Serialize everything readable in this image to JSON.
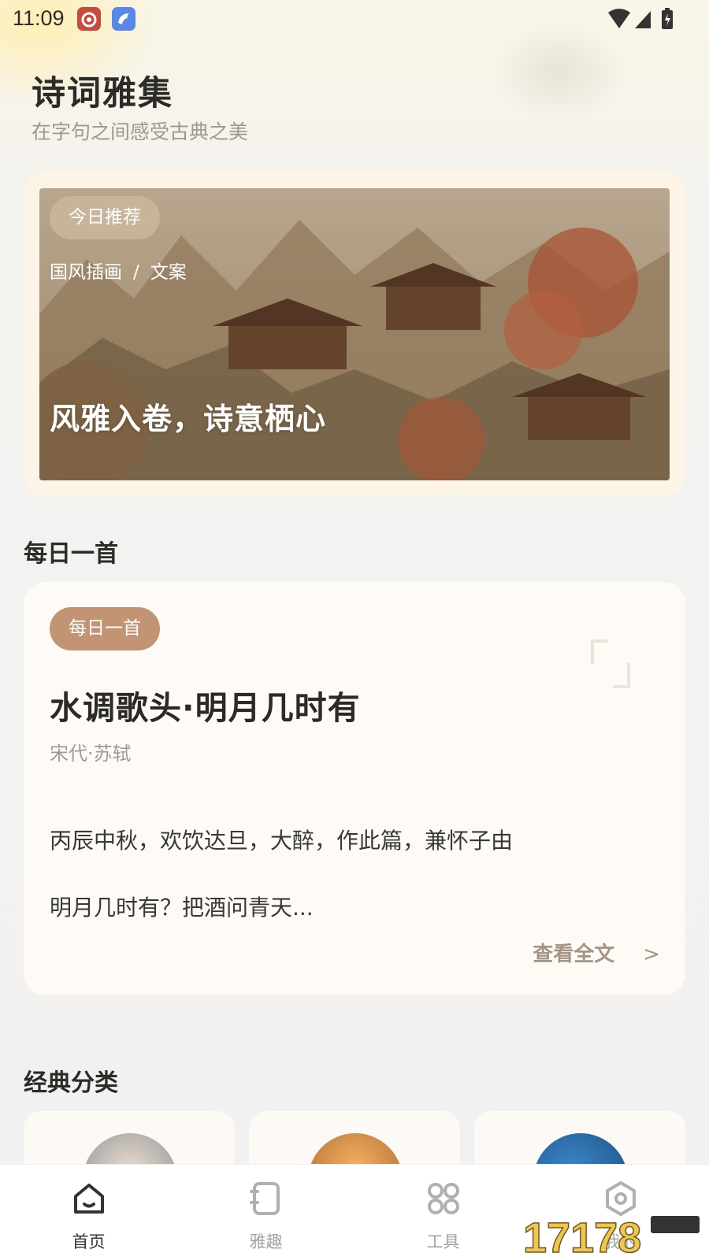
{
  "status_bar": {
    "time": "11:09"
  },
  "header": {
    "title": "诗词雅集",
    "subtitle": "在字句之间感受古典之美"
  },
  "banner": {
    "tag": "今日推荐",
    "crumb_1": "国风插画",
    "crumb_sep": "/",
    "crumb_2": "文案",
    "slogan": "风雅入卷，诗意栖心"
  },
  "daily_section": {
    "title": "每日一首"
  },
  "daily_poem": {
    "tag": "每日一首",
    "title": "水调歌头·明月几时有",
    "meta": "宋代·苏轼",
    "line_1": "丙辰中秋，欢饮达旦，大醉，作此篇，兼怀子由",
    "line_2": "明月几时有？把酒问青天...",
    "more_label": "查看全文",
    "more_arrow": ">"
  },
  "category_section": {
    "title": "经典分类"
  },
  "bottom_nav": {
    "items": [
      {
        "label": "首页",
        "icon": "home-icon",
        "active": true
      },
      {
        "label": "雅趣",
        "icon": "notebook-icon",
        "active": false
      },
      {
        "label": "工具",
        "icon": "grid-icon",
        "active": false
      },
      {
        "label": "我的",
        "icon": "hexagon-settings-icon",
        "active": false
      }
    ]
  },
  "colors": {
    "accent_tag": "#c29474",
    "text_primary": "#2d2b28",
    "text_muted": "#9d9890"
  }
}
